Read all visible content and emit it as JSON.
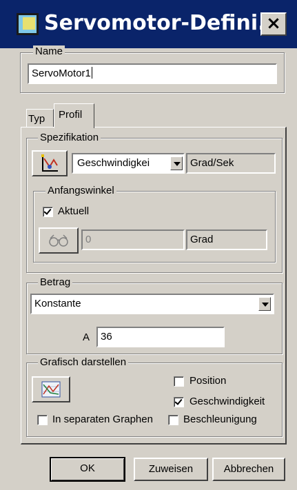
{
  "window": {
    "title": "Servomotor-Defini...",
    "close_glyph": "×",
    "app_icon": "window-app-icon"
  },
  "name_group": {
    "legend": "Name",
    "value": "ServoMotor1"
  },
  "tabs": [
    {
      "label": "Typ",
      "selected": false
    },
    {
      "label": "Profil",
      "selected": true
    }
  ],
  "spezifikation": {
    "legend": "Spezifikation",
    "icon": "motion-spec-icon",
    "select_value": "Geschwindigkei",
    "unit": "Grad/Sek",
    "anfangswinkel": {
      "legend": "Anfangswinkel",
      "checkbox_label": "Aktuell",
      "checkbox_checked": true,
      "measure_icon": "glasses-icon",
      "value": "0",
      "unit": "Grad"
    }
  },
  "betrag": {
    "legend": "Betrag",
    "select_value": "Konstante",
    "param_label": "A",
    "param_value": "36"
  },
  "grafisch": {
    "legend": "Grafisch darstellen",
    "graph_icon": "graph-icon",
    "checkboxes": [
      {
        "label": "Position",
        "checked": false
      },
      {
        "label": "Geschwindigkeit",
        "checked": true
      },
      {
        "label": "Beschleunigung",
        "checked": false
      }
    ],
    "separate": {
      "label": "In separaten Graphen",
      "checked": false
    }
  },
  "buttons": {
    "ok": "OK",
    "assign": "Zuweisen",
    "cancel": "Abbrechen"
  },
  "colors": {
    "titlebar": "#0a246a",
    "face": "#d4d0c8"
  }
}
